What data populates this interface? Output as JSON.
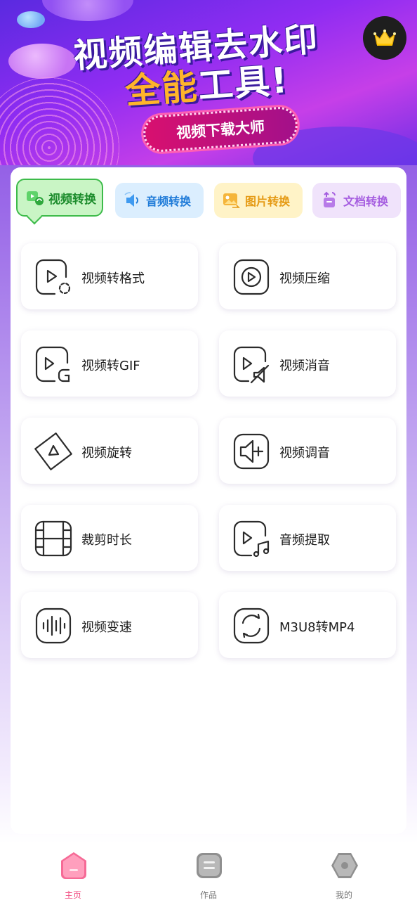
{
  "banner": {
    "title_line1": "视频编辑去水印",
    "title_line2_accent": "全能",
    "title_line2_rest": "工具!",
    "pill_text": "视频下载大师"
  },
  "vip_button": {
    "icon": "crown-icon",
    "color": "#ffd23a"
  },
  "tabs": [
    {
      "label": "视频转换",
      "icon": "video-convert-icon",
      "active": true,
      "color": "#1c8c2c"
    },
    {
      "label": "音频转换",
      "icon": "audio-convert-icon",
      "active": false,
      "color": "#1f7bd8"
    },
    {
      "label": "图片转换",
      "icon": "image-convert-icon",
      "active": false,
      "color": "#e59a14"
    },
    {
      "label": "文档转换",
      "icon": "doc-convert-icon",
      "active": false,
      "color": "#a55de0"
    }
  ],
  "features": [
    {
      "label": "视频转格式",
      "icon": "video-format-icon"
    },
    {
      "label": "视频压缩",
      "icon": "video-compress-icon"
    },
    {
      "label": "视频转GIF",
      "icon": "video-gif-icon"
    },
    {
      "label": "视频消音",
      "icon": "video-mute-icon"
    },
    {
      "label": "视频旋转",
      "icon": "video-rotate-icon"
    },
    {
      "label": "视频调音",
      "icon": "video-volume-icon"
    },
    {
      "label": "裁剪时长",
      "icon": "film-crop-icon"
    },
    {
      "label": "音频提取",
      "icon": "audio-extract-icon"
    },
    {
      "label": "视频变速",
      "icon": "waveform-speed-icon"
    },
    {
      "label": "M3U8转MP4",
      "icon": "m3u8-convert-icon"
    }
  ],
  "bottom_nav": [
    {
      "label": "主页",
      "icon": "home-icon",
      "active": true
    },
    {
      "label": "作品",
      "icon": "works-icon",
      "active": false
    },
    {
      "label": "我的",
      "icon": "profile-icon",
      "active": false
    }
  ]
}
